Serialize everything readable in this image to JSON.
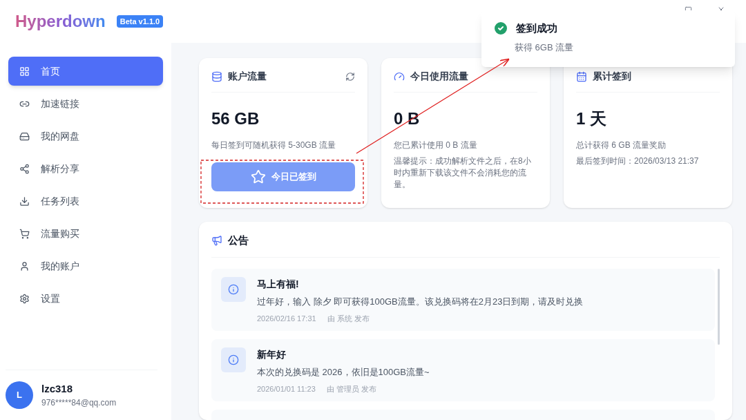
{
  "app": {
    "logo": "Hyperdown",
    "version": "Beta v1.1.0"
  },
  "sidebar": {
    "items": [
      {
        "label": "首页",
        "selected": true
      },
      {
        "label": "加速链接",
        "selected": false
      },
      {
        "label": "我的网盘",
        "selected": false
      },
      {
        "label": "解析分享",
        "selected": false
      },
      {
        "label": "任务列表",
        "selected": false
      },
      {
        "label": "流量购买",
        "selected": false
      },
      {
        "label": "我的账户",
        "selected": false
      },
      {
        "label": "设置",
        "selected": false
      }
    ],
    "user": {
      "initial": "L",
      "name": "lzc318",
      "email": "976*****84@qq.com"
    }
  },
  "cards": [
    {
      "title": "账户流量",
      "value": "56 GB",
      "lines": [
        "每日签到可随机获得 5-30GB 流量"
      ],
      "button": {
        "label": "今日已签到",
        "checked_in": true
      }
    },
    {
      "title": "今日使用流量",
      "value": "0 B",
      "lines": [
        "您已累计使用 0 B 流量",
        "温馨提示：成功解析文件之后，在8小时内重新下载该文件不会消耗您的流量。"
      ]
    },
    {
      "title": "累计签到",
      "value": "1 天",
      "lines": [
        "总计获得 6 GB 流量奖励",
        "最后签到时间：2026/03/13 21:37"
      ]
    }
  ],
  "announcements": {
    "title": "公告",
    "items": [
      {
        "title": "马上有福!",
        "body": "过年好，输入 除夕 即可获得100GB流量。该兑换码将在2月23日到期，请及时兑换",
        "date": "2026/02/16 17:31",
        "author": "由 系统 发布"
      },
      {
        "title": "新年好",
        "body": "本次的兑换码是 2026，依旧是100GB流量~",
        "date": "2026/01/01 11:23",
        "author": "由 管理员 发布"
      }
    ]
  },
  "toast": {
    "title": "签到成功",
    "message": "获得 6GB 流量"
  }
}
